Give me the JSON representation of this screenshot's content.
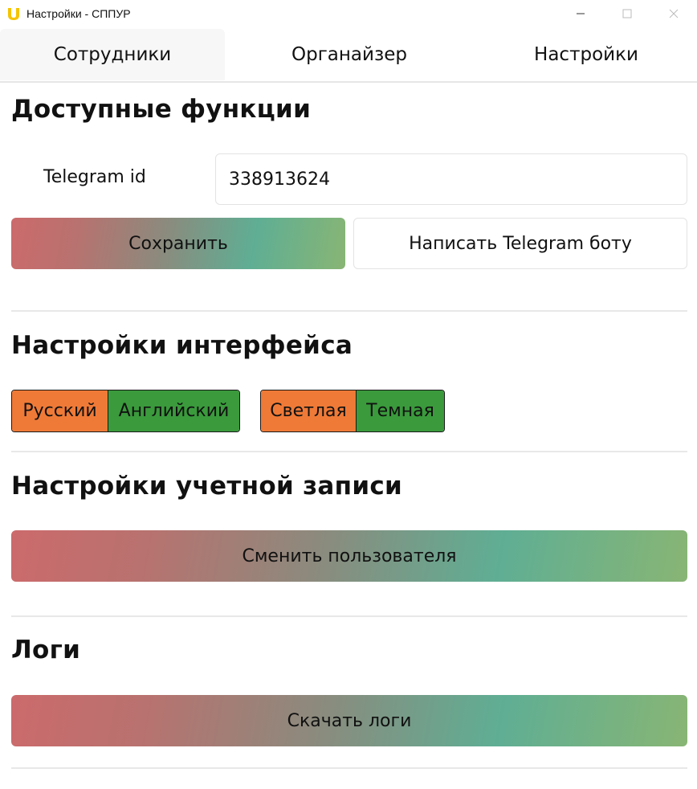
{
  "window": {
    "title": "Настройки - СППУР",
    "icon": "app-logo-icon",
    "controls": [
      "minimize-icon",
      "maximize-icon",
      "close-icon"
    ]
  },
  "tabs": [
    {
      "label": "Сотрудники",
      "active": true
    },
    {
      "label": "Органайзер",
      "active": false
    },
    {
      "label": "Настройки",
      "active": false
    }
  ],
  "functions": {
    "title": "Доступные функции",
    "telegram_label": "Telegram id",
    "telegram_value": "338913624",
    "save_label": "Сохранить",
    "write_bot_label": "Написать Telegram боту"
  },
  "interface": {
    "title": "Настройки интерфейса",
    "language": {
      "options": [
        "Русский",
        "Английский"
      ],
      "selected": "Русский"
    },
    "theme": {
      "options": [
        "Светлая",
        "Темная"
      ],
      "selected": "Светлая"
    }
  },
  "account": {
    "title": "Настройки учетной записи",
    "switch_user_label": "Сменить пользователя"
  },
  "logs": {
    "title": "Логи",
    "download_label": "Скачать логи"
  },
  "colors": {
    "accent_orange": "#ef7a37",
    "accent_green": "#3a9a3c",
    "gradient_start": "#cc6a6c",
    "gradient_end": "#88b574",
    "logo_yellow": "#f5c400"
  }
}
